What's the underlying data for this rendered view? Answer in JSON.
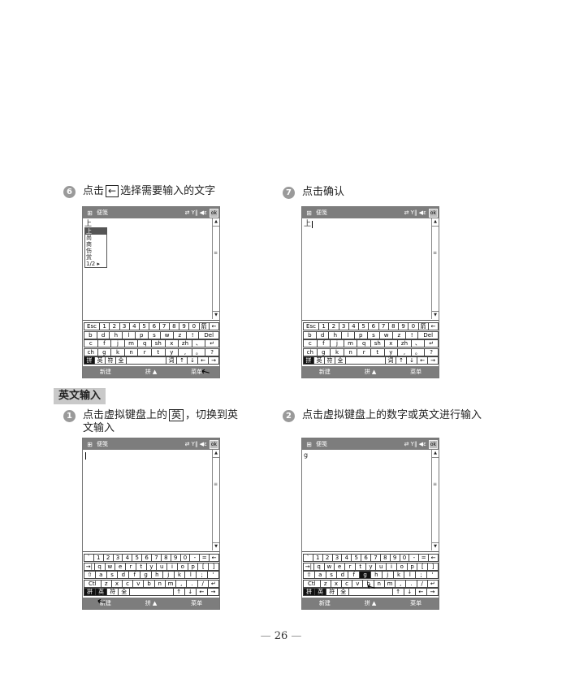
{
  "steps": {
    "s6": {
      "num": "6",
      "pre": "点击",
      "key": "←",
      "post": "选择需要输入的文字"
    },
    "s7": {
      "num": "7",
      "text": "点击确认"
    },
    "s1": {
      "num": "1",
      "pre": "点击虚拟键盘上的",
      "key": "英",
      "post": "，切换到英\n文输入"
    },
    "s2": {
      "num": "2",
      "text": "点击虚拟键盘上的数字或英文进行输入"
    }
  },
  "section_title": "英文输入",
  "page_number": "26",
  "screens": {
    "title": "便笺",
    "status": "⇄ Y‖ ◀ε",
    "ok": "ok",
    "menu": {
      "left": "新建",
      "mid": "拼 ▲",
      "right": "菜单"
    },
    "a": {
      "content": "上",
      "candidates": [
        "上",
        "尚",
        "商",
        "伤",
        "赏"
      ],
      "cand_footer": "1/2 ▸"
    },
    "b": {
      "content": "上"
    },
    "d": {
      "content": "g"
    }
  },
  "kb_pinyin": [
    [
      "Esc",
      "1",
      "2",
      "3",
      "4",
      "5",
      "6",
      "7",
      "8",
      "9",
      "0",
      "箭",
      "←"
    ],
    [
      "b",
      "d",
      "h",
      "l",
      "p",
      "s",
      "w",
      "z",
      "!",
      "Del"
    ],
    [
      "c",
      "f",
      "j",
      "m",
      "q",
      "sh",
      "x",
      "zh",
      "、",
      "↵"
    ],
    [
      "ch",
      "g",
      "k",
      "n",
      "r",
      "t",
      "y",
      ",",
      "。",
      "?"
    ],
    [
      "拼",
      "英",
      "符",
      "全",
      "",
      "词",
      "↑",
      "↓",
      "←",
      "→"
    ]
  ],
  "kb_english": [
    [
      "`",
      "1",
      "2",
      "3",
      "4",
      "5",
      "6",
      "7",
      "8",
      "9",
      "0",
      "-",
      "=",
      "←"
    ],
    [
      "→|",
      "q",
      "w",
      "e",
      "r",
      "t",
      "y",
      "u",
      "i",
      "o",
      "p",
      "[",
      "]"
    ],
    [
      "⇧",
      "a",
      "s",
      "d",
      "f",
      "g",
      "h",
      "j",
      "k",
      "l",
      ";",
      "'"
    ],
    [
      "Ctl",
      "z",
      "x",
      "c",
      "v",
      "b",
      "n",
      "m",
      ",",
      ".",
      "/",
      "↵"
    ],
    [
      "拼",
      "英",
      "符",
      "全",
      "",
      "↑",
      "↓",
      "←",
      "→"
    ]
  ]
}
